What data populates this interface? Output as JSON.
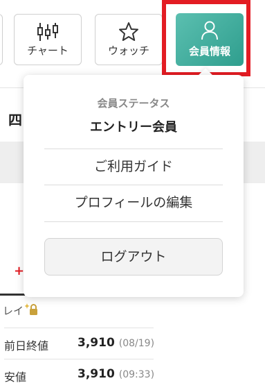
{
  "toolbar": {
    "chart_label": "チャート",
    "watch_label": "ウォッチ",
    "member_label": "会員情報"
  },
  "background": {
    "tab_label_partial": "四",
    "replay_label": "レイ",
    "price_rows": [
      {
        "label": "前日終値",
        "value": "3,910",
        "time": "(08/19)"
      },
      {
        "label": "安値",
        "value": "3,910",
        "time": "(09:33)"
      }
    ]
  },
  "dropdown": {
    "status_label": "会員ステータス",
    "status_value": "エントリー会員",
    "items": [
      {
        "label": "ご利用ガイド"
      },
      {
        "label": "プロフィールの編集"
      }
    ],
    "logout_label": "ログアウト"
  },
  "colors": {
    "member_accent": "#3aa899",
    "highlight_frame": "#e31c23"
  },
  "icons": {
    "chart": "candlestick-chart-icon",
    "watch": "star-icon",
    "member": "user-icon",
    "lock": "lock-icon"
  }
}
